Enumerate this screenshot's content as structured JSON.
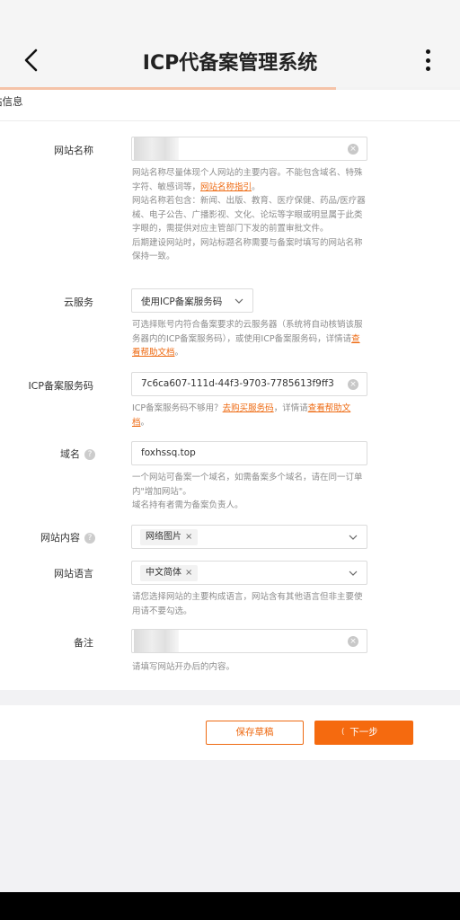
{
  "header": {
    "title": "ICP代备案管理系统",
    "back_icon": "chevron-left-icon",
    "more_icon": "more-vertical-icon"
  },
  "progress": {
    "fraction": 0.73,
    "color": "#f5c3a8"
  },
  "section": {
    "title": "站信息"
  },
  "form": {
    "site_name": {
      "label": "网站名称",
      "help_1": "网站名称尽量体现个人网站的主要内容。不能包含域名、特殊字符、敏感词等，",
      "help_link": "网站名称指引",
      "help_2": "。",
      "help_3": "网站名称若包含：新闻、出版、教育、医疗保健、药品/医疗器械、电子公告、广播影视、文化、论坛等字眼或明显属于此类字眼的，需提供对应主管部门下发的前置审批文件。",
      "help_4": "后期建设网站时，网站标题名称需要与备案时填写的网站名称保持一致。"
    },
    "cloud_service": {
      "label": "云服务",
      "selected": "使用ICP备案服务码",
      "help_1": "可选择账号内符合备案要求的云服务器（系统将自动核销该服务器内的ICP备案服务码），或使用ICP备案服务码，详情请",
      "help_link": "查看帮助文档",
      "help_2": "。"
    },
    "icp_code": {
      "label": "ICP备案服务码",
      "value": "7c6ca607-111d-44f3-9703-7785613f9ff3",
      "help_1": "ICP备案服务码不够用？",
      "help_link_1": "去购买服务码",
      "help_2": "，详情请",
      "help_link_2": "查看帮助文档",
      "help_3": "。"
    },
    "domain": {
      "label": "域名",
      "value": "foxhssq.top",
      "help_1": "一个网站可备案一个域名，如需备案多个域名，请在同一订单内\"增加网站\"。",
      "help_2": "域名持有者需为备案负责人。"
    },
    "content": {
      "label": "网站内容",
      "tag": "网络图片"
    },
    "language": {
      "label": "网站语言",
      "tag": "中文简体",
      "help": "请您选择网站的主要构成语言，网站含有其他语言但非主要使用请不要勾选。"
    },
    "remark": {
      "label": "备注",
      "help": "请填写网站开办后的内容。"
    }
  },
  "footer": {
    "save_draft": "保存草稿",
    "next": "下一步"
  },
  "colors": {
    "accent": "#f56a0f",
    "link": "#ee6a12"
  }
}
